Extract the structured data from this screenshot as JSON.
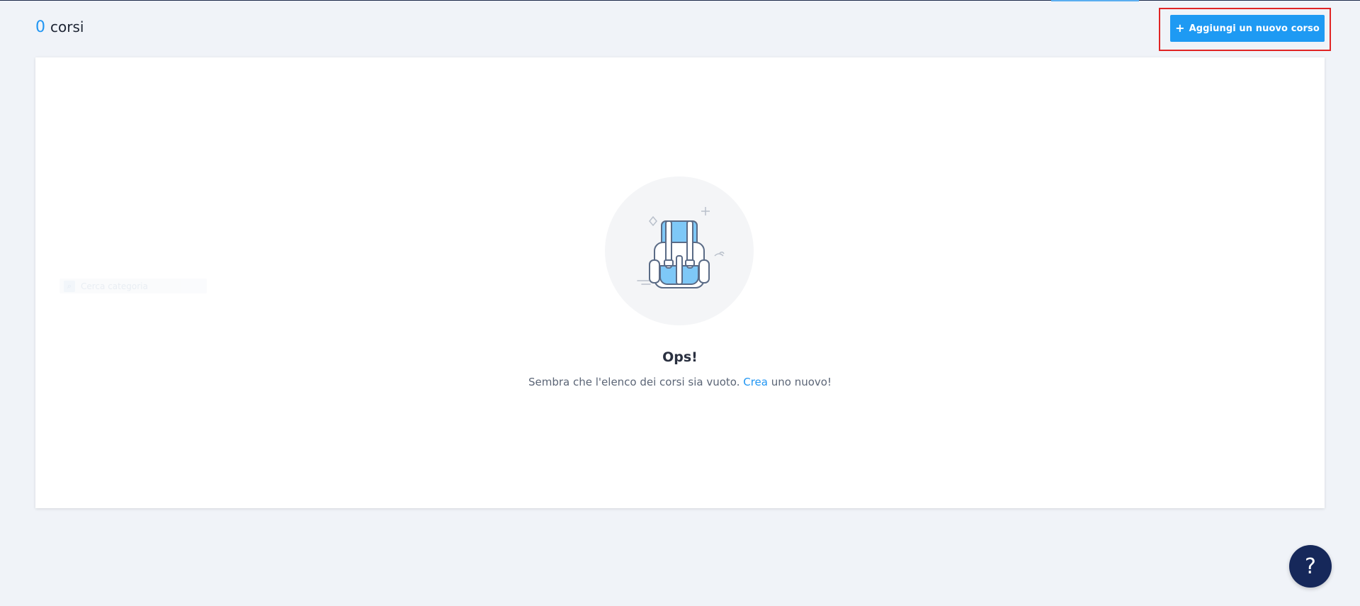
{
  "header": {
    "count": "0",
    "count_label": "corsi"
  },
  "toolbar": {
    "add_plus": "+",
    "add_label": "Aggiungi un nuovo corso"
  },
  "sidebar_ghost": {
    "label": "Cerca categoria"
  },
  "empty_state": {
    "title": "Ops!",
    "text_before": "Sembra che l'elenco dei corsi sia vuoto. ",
    "link_label": "Crea",
    "text_after": " uno nuovo!"
  },
  "help": {
    "label": "?"
  },
  "colors": {
    "accent": "#1e9af3",
    "help_bg": "#16285a",
    "background": "#f0f3f8",
    "highlight": "#e02424"
  },
  "icons": {
    "add": "plus-icon",
    "empty": "backpack-icon",
    "help": "question-icon"
  }
}
